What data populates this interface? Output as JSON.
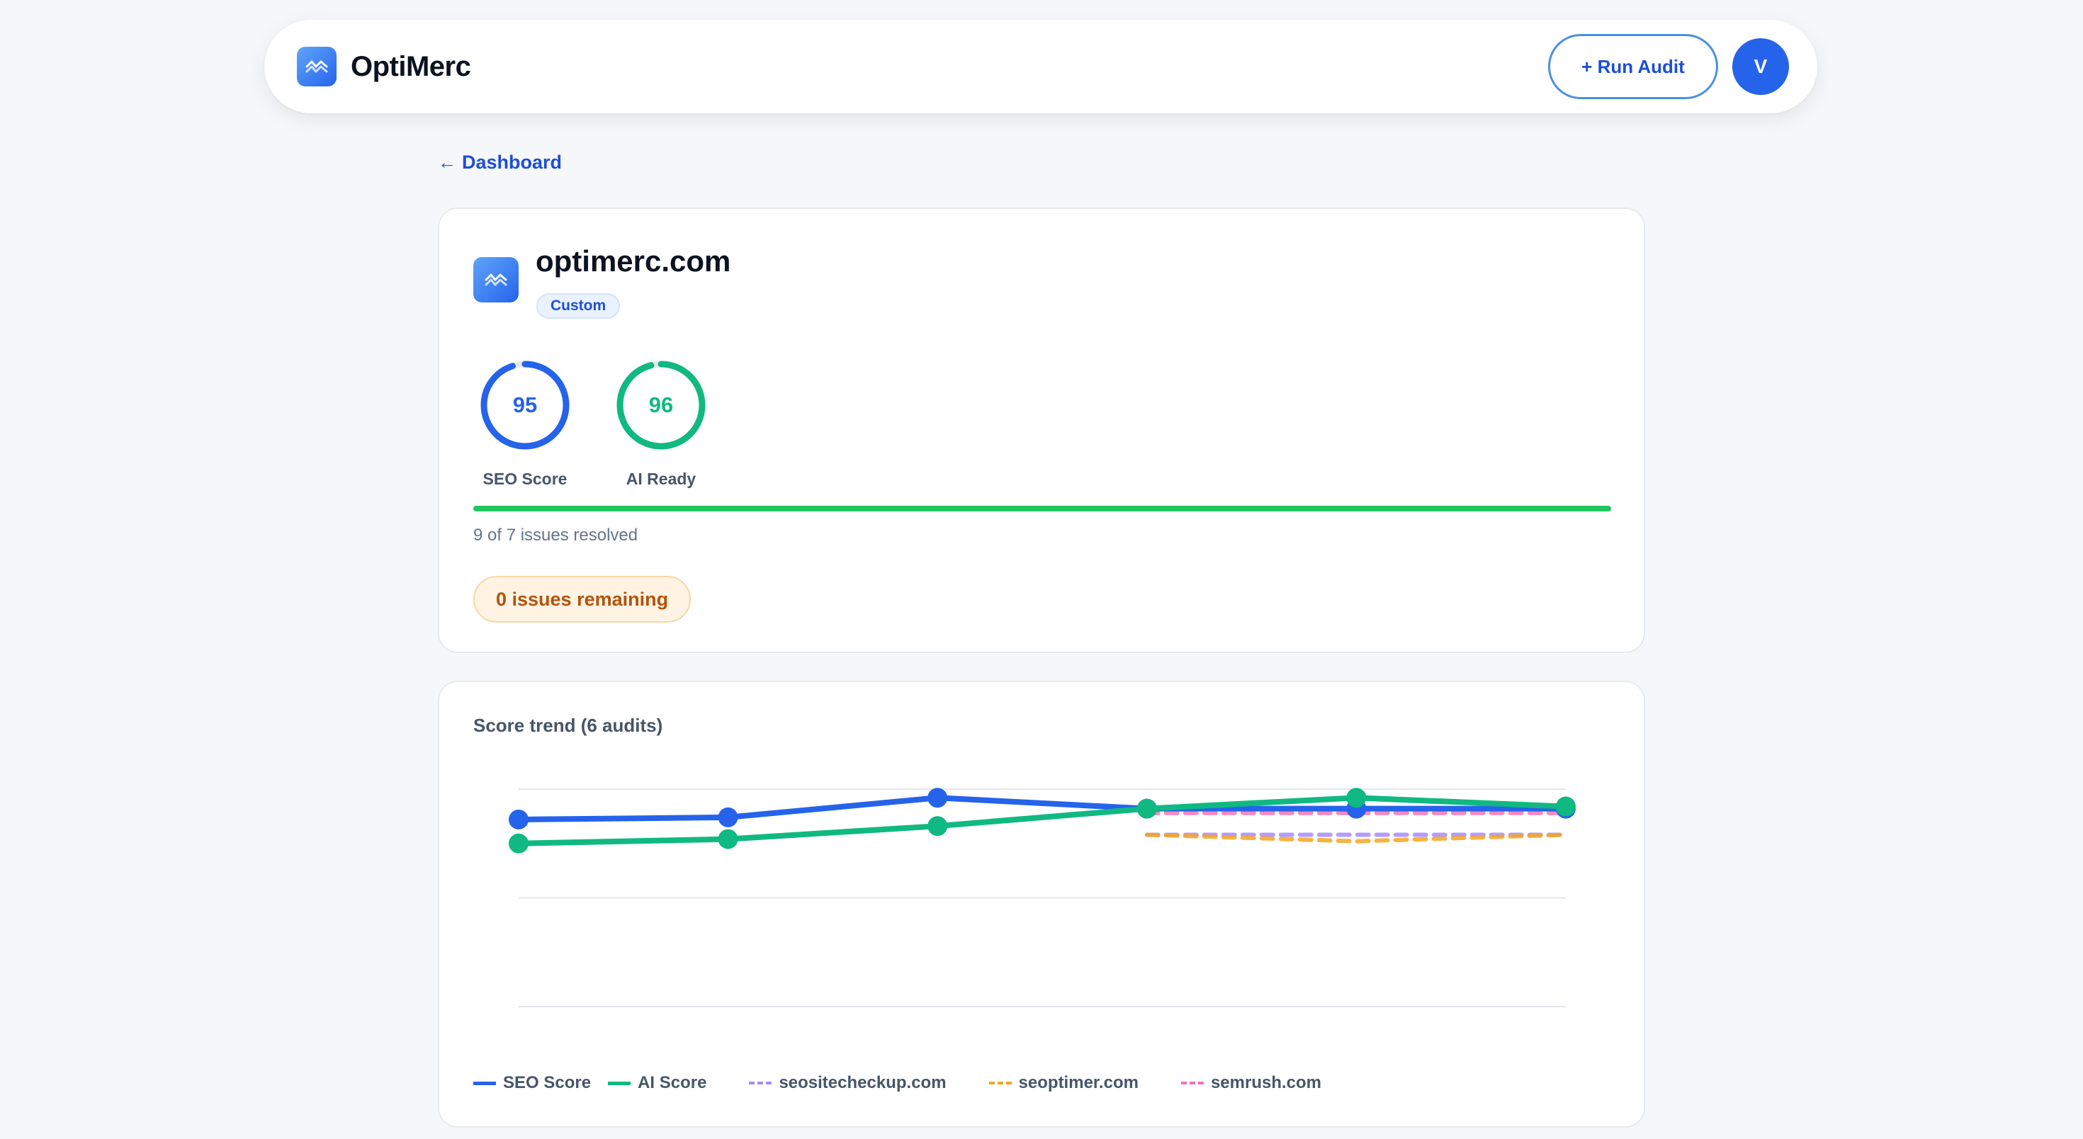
{
  "app": {
    "name": "OptiMerc",
    "run_audit_label": "+ Run Audit",
    "avatar_initial": "V"
  },
  "nav": {
    "back_label": "Dashboard"
  },
  "site": {
    "domain": "optimerc.com",
    "plan_badge": "Custom",
    "scores": [
      {
        "label": "SEO Score",
        "value": 95,
        "color": "#2563eb"
      },
      {
        "label": "AI Ready",
        "value": 96,
        "color": "#10b981"
      }
    ],
    "progress_fraction": 1.0,
    "progress_color": "#22c55e",
    "resolved_text": "9 of 7 issues resolved",
    "remaining_text": "0 issues remaining"
  },
  "trend": {
    "title": "Score trend (6 audits)"
  },
  "chart_data": {
    "type": "line",
    "title": "Score trend (6 audits)",
    "x": [
      1,
      2,
      3,
      4,
      5,
      6
    ],
    "ylim": [
      0,
      100
    ],
    "grid": true,
    "legend": "bottom-left",
    "series": [
      {
        "name": "SEO Score",
        "style": "solid",
        "color": "#2563eb",
        "values": [
          86,
          87,
          96,
          91,
          91,
          91
        ]
      },
      {
        "name": "AI Score",
        "style": "solid",
        "color": "#10b981",
        "values": [
          75,
          77,
          83,
          91,
          96,
          92
        ]
      },
      {
        "name": "seositecheckup.com",
        "style": "dashed",
        "color": "#a78bfa",
        "values": [
          null,
          null,
          null,
          79,
          79,
          79
        ]
      },
      {
        "name": "seoptimer.com",
        "style": "dashed",
        "color": "#f5a623",
        "values": [
          null,
          null,
          null,
          79,
          76,
          79
        ]
      },
      {
        "name": "semrush.com",
        "style": "dashed",
        "color": "#f472b6",
        "values": [
          null,
          null,
          null,
          89,
          89,
          89
        ]
      }
    ]
  }
}
